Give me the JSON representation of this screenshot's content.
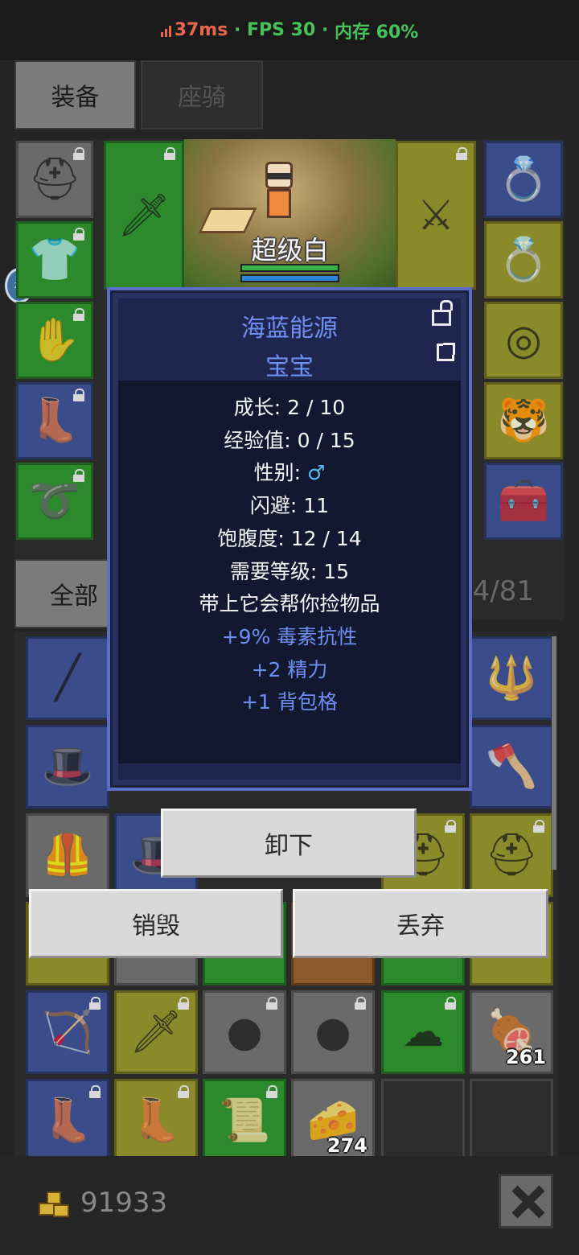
{
  "status_bar": {
    "ping": "37ms",
    "fps": "FPS 30",
    "memory": "内存 60%"
  },
  "tabs": {
    "equipment": "装备",
    "mount": "座骑"
  },
  "character": {
    "name": "超级白",
    "hp_fraction": 1.0,
    "mp_fraction": 1.0
  },
  "equipment_slots": [
    {
      "icon": "horned-helmet-icon",
      "color": "gray",
      "locked": true
    },
    {
      "icon": "chainmail-armor-icon",
      "color": "green",
      "locked": true
    },
    {
      "icon": "gauntlet-icon",
      "color": "green",
      "locked": true
    },
    {
      "icon": "leather-boots-icon",
      "color": "blue",
      "locked": true
    },
    {
      "icon": "belt-icon",
      "color": "green",
      "locked": true
    },
    {
      "icon": "purple-dagger-icon",
      "color": "green",
      "locked": true
    },
    {
      "icon": "curved-sword-icon",
      "color": "yellow",
      "locked": true
    },
    {
      "icon": "amethyst-necklace-icon",
      "color": "blue",
      "locked": false
    },
    {
      "icon": "sapphire-ring-icon",
      "color": "yellow",
      "locked": false
    },
    {
      "icon": "emerald-ring-icon",
      "color": "yellow",
      "locked": false
    },
    {
      "icon": "pet-tiger-icon",
      "color": "yellow",
      "locked": false
    },
    {
      "icon": "treasure-chest-icon",
      "color": "blue",
      "locked": false
    }
  ],
  "bag": {
    "tab_all": "全部",
    "count": "84/81",
    "visible_counts": [
      "261",
      "274"
    ]
  },
  "popup": {
    "name": "海蓝能源",
    "subtitle": "宝宝",
    "stats": [
      "成长: 2 / 10",
      "经验值: 0 / 15",
      "性别: ",
      "闪避: 11",
      "饱腹度: 12 / 14",
      "需要等级: 15",
      "带上它会帮你捡物品"
    ],
    "gender_symbol": "♂",
    "bonuses": [
      "+9% 毒素抗性",
      "+2 精力",
      "+1 背包格"
    ]
  },
  "actions": {
    "unequip": "卸下",
    "destroy": "销毁",
    "discard": "丢弃"
  },
  "footer": {
    "gold": "91933"
  }
}
